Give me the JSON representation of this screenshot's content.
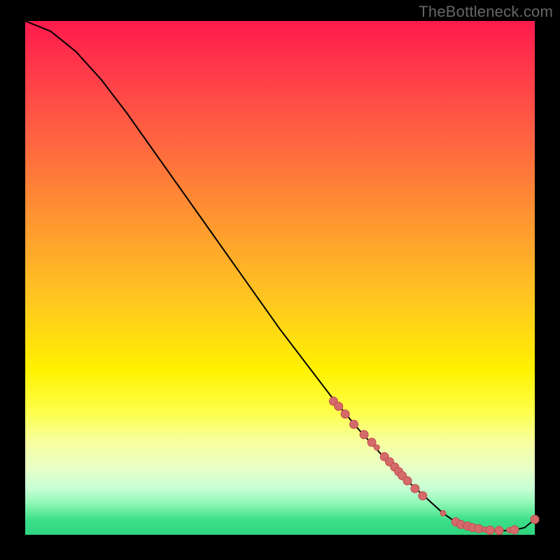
{
  "watermark": "TheBottleneck.com",
  "colors": {
    "curve": "#000000",
    "dot_fill": "#d46a6a",
    "dot_stroke": "#c24f4f"
  },
  "chart_data": {
    "type": "line",
    "title": "",
    "xlabel": "",
    "ylabel": "",
    "xlim": [
      0,
      100
    ],
    "ylim": [
      0,
      100
    ],
    "grid": false,
    "legend": false,
    "series": [
      {
        "name": "curve",
        "x": [
          0,
          5,
          10,
          15,
          20,
          25,
          30,
          35,
          40,
          45,
          50,
          55,
          60,
          65,
          70,
          75,
          80,
          82,
          84,
          86,
          88,
          90,
          92,
          94,
          96,
          98,
          100
        ],
        "y": [
          100,
          98,
          94,
          88.5,
          82,
          75,
          68,
          61,
          54,
          47,
          40,
          33.5,
          27,
          21,
          15.5,
          10.5,
          6,
          4.2,
          2.8,
          1.8,
          1.2,
          0.9,
          0.8,
          0.8,
          0.9,
          1.4,
          3
        ],
        "stroke_width": 2
      }
    ],
    "dots": {
      "name": "highlighted-points",
      "radius": 6,
      "points": [
        {
          "x": 60.5,
          "y": 26.0,
          "r": 6
        },
        {
          "x": 61.5,
          "y": 25.0,
          "r": 6
        },
        {
          "x": 62.8,
          "y": 23.5,
          "r": 6
        },
        {
          "x": 64.5,
          "y": 21.5,
          "r": 6
        },
        {
          "x": 66.5,
          "y": 19.5,
          "r": 6
        },
        {
          "x": 68.0,
          "y": 18.0,
          "r": 6
        },
        {
          "x": 69.0,
          "y": 17.0,
          "r": 4
        },
        {
          "x": 70.5,
          "y": 15.2,
          "r": 6
        },
        {
          "x": 71.5,
          "y": 14.2,
          "r": 6
        },
        {
          "x": 72.5,
          "y": 13.2,
          "r": 6
        },
        {
          "x": 73.3,
          "y": 12.3,
          "r": 6
        },
        {
          "x": 74.0,
          "y": 11.5,
          "r": 6
        },
        {
          "x": 75.0,
          "y": 10.5,
          "r": 6
        },
        {
          "x": 76.5,
          "y": 9.0,
          "r": 6
        },
        {
          "x": 78.0,
          "y": 7.6,
          "r": 6
        },
        {
          "x": 82.0,
          "y": 4.2,
          "r": 4
        },
        {
          "x": 84.5,
          "y": 2.5,
          "r": 6
        },
        {
          "x": 85.5,
          "y": 2.0,
          "r": 6
        },
        {
          "x": 86.8,
          "y": 1.7,
          "r": 6
        },
        {
          "x": 87.8,
          "y": 1.4,
          "r": 6
        },
        {
          "x": 89.0,
          "y": 1.2,
          "r": 6
        },
        {
          "x": 90.2,
          "y": 1.0,
          "r": 4
        },
        {
          "x": 91.2,
          "y": 0.9,
          "r": 6
        },
        {
          "x": 93.0,
          "y": 0.85,
          "r": 6
        },
        {
          "x": 95.0,
          "y": 0.9,
          "r": 4
        },
        {
          "x": 96.0,
          "y": 0.95,
          "r": 6
        },
        {
          "x": 100.0,
          "y": 3.0,
          "r": 6
        }
      ]
    }
  }
}
